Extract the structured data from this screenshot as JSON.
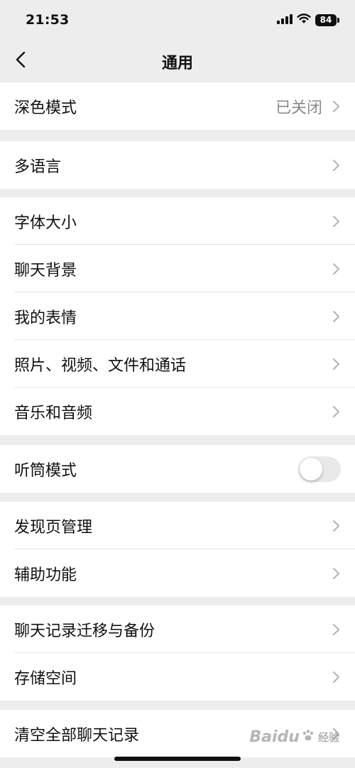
{
  "status_bar": {
    "time": "21:53",
    "battery": "84",
    "icons": [
      "signal-icon",
      "wifi-icon",
      "battery-icon"
    ]
  },
  "nav": {
    "title": "通用",
    "back_icon": "chevron-left-icon"
  },
  "settings": {
    "dark_mode": {
      "label": "深色模式",
      "value": "已关闭"
    },
    "language": {
      "label": "多语言"
    },
    "font_size": {
      "label": "字体大小"
    },
    "chat_background": {
      "label": "聊天背景"
    },
    "my_stickers": {
      "label": "我的表情"
    },
    "media": {
      "label": "照片、视频、文件和通话"
    },
    "music_audio": {
      "label": "音乐和音频"
    },
    "earpiece_mode": {
      "label": "听筒模式",
      "enabled": false
    },
    "discover_management": {
      "label": "发现页管理"
    },
    "accessibility": {
      "label": "辅助功能"
    },
    "chat_backup": {
      "label": "聊天记录迁移与备份"
    },
    "storage": {
      "label": "存储空间"
    },
    "clear_chats": {
      "label": "清空全部聊天记录"
    }
  },
  "watermark": {
    "brand": "Baidu",
    "sub": "经验"
  },
  "colors": {
    "background": "#ededed",
    "row_background": "#ffffff",
    "secondary_text": "#8a8a8a",
    "chevron": "#b2b2b2",
    "toggle_off": "#e9e9ea"
  }
}
